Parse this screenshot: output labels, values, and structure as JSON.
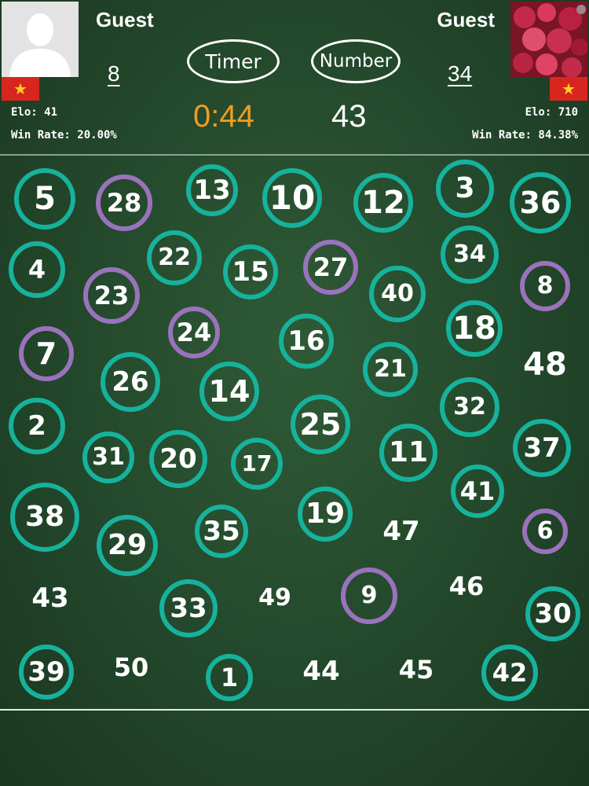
{
  "players": {
    "left": {
      "name": "Guest",
      "score": "8",
      "elo": "Elo: 41",
      "win_rate": "Win Rate: 20.00%",
      "flag": "★",
      "avatar": "person-silhouette"
    },
    "right": {
      "name": "Guest",
      "score": "34",
      "elo": "Elo: 710",
      "win_rate": "Win Rate: 84.38%",
      "flag": "★",
      "avatar": "roses-photo"
    }
  },
  "controls": {
    "timer_label": "Timer",
    "number_label": "Number"
  },
  "status": {
    "timer": "0:44",
    "target": "43"
  },
  "colors": {
    "board": "#23472b",
    "player1_ring": "#16b29c",
    "player2_ring": "#9a72bd",
    "timer": "#f39c1e"
  },
  "tiles": [
    {
      "n": "5",
      "c": "teal"
    },
    {
      "n": "28",
      "c": "purple"
    },
    {
      "n": "13",
      "c": "teal"
    },
    {
      "n": "10",
      "c": "teal"
    },
    {
      "n": "12",
      "c": "teal"
    },
    {
      "n": "3",
      "c": "teal"
    },
    {
      "n": "36",
      "c": "teal"
    },
    {
      "n": "4",
      "c": "teal"
    },
    {
      "n": "22",
      "c": "teal"
    },
    {
      "n": "15",
      "c": "teal"
    },
    {
      "n": "27",
      "c": "purple"
    },
    {
      "n": "34",
      "c": "teal"
    },
    {
      "n": "23",
      "c": "purple"
    },
    {
      "n": "40",
      "c": "teal"
    },
    {
      "n": "8",
      "c": "purple"
    },
    {
      "n": "24",
      "c": "purple"
    },
    {
      "n": "18",
      "c": "teal"
    },
    {
      "n": "7",
      "c": "purple"
    },
    {
      "n": "16",
      "c": "teal"
    },
    {
      "n": "48",
      "c": ""
    },
    {
      "n": "26",
      "c": "teal"
    },
    {
      "n": "14",
      "c": "teal"
    },
    {
      "n": "21",
      "c": "teal"
    },
    {
      "n": "32",
      "c": "teal"
    },
    {
      "n": "2",
      "c": "teal"
    },
    {
      "n": "25",
      "c": "teal"
    },
    {
      "n": "37",
      "c": "teal"
    },
    {
      "n": "31",
      "c": "teal"
    },
    {
      "n": "20",
      "c": "teal"
    },
    {
      "n": "17",
      "c": "teal"
    },
    {
      "n": "11",
      "c": "teal"
    },
    {
      "n": "41",
      "c": "teal"
    },
    {
      "n": "38",
      "c": "teal"
    },
    {
      "n": "19",
      "c": "teal"
    },
    {
      "n": "35",
      "c": "teal"
    },
    {
      "n": "47",
      "c": ""
    },
    {
      "n": "6",
      "c": "purple"
    },
    {
      "n": "29",
      "c": "teal"
    },
    {
      "n": "43",
      "c": ""
    },
    {
      "n": "49",
      "c": ""
    },
    {
      "n": "9",
      "c": "purple"
    },
    {
      "n": "46",
      "c": ""
    },
    {
      "n": "33",
      "c": "teal"
    },
    {
      "n": "30",
      "c": "teal"
    },
    {
      "n": "39",
      "c": "teal"
    },
    {
      "n": "50",
      "c": ""
    },
    {
      "n": "1",
      "c": "teal"
    },
    {
      "n": "44",
      "c": ""
    },
    {
      "n": "45",
      "c": ""
    },
    {
      "n": "42",
      "c": "teal"
    }
  ]
}
